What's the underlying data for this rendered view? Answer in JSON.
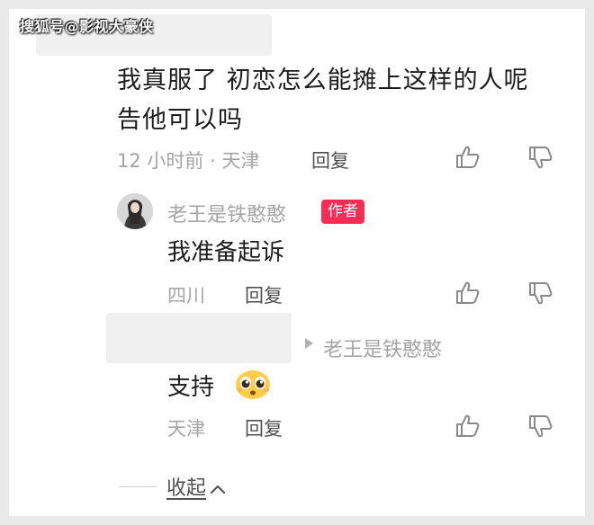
{
  "watermark": "搜狐号@影视大豪侠",
  "comment": {
    "text": "我真服了 初恋怎么能摊上这样的人呢 告他可以吗",
    "time_location": "12 小时前 · 天津",
    "reply_label": "回复",
    "like_icon": "thumbs-up-icon",
    "dislike_icon": "thumbs-down-icon"
  },
  "replies": [
    {
      "username": "老王是铁憨憨",
      "badge": "作者",
      "text": "我准备起诉",
      "location": "四川",
      "reply_label": "回复"
    },
    {
      "reply_to": "老王是铁憨憨",
      "text": "支持",
      "emoji": "pleading-face-emoji",
      "location": "天津",
      "reply_label": "回复"
    }
  ],
  "collapse_label": "收起",
  "colors": {
    "badge": "#fe2c55",
    "meta": "#a4a4a4",
    "text": "#1c1c1c"
  }
}
